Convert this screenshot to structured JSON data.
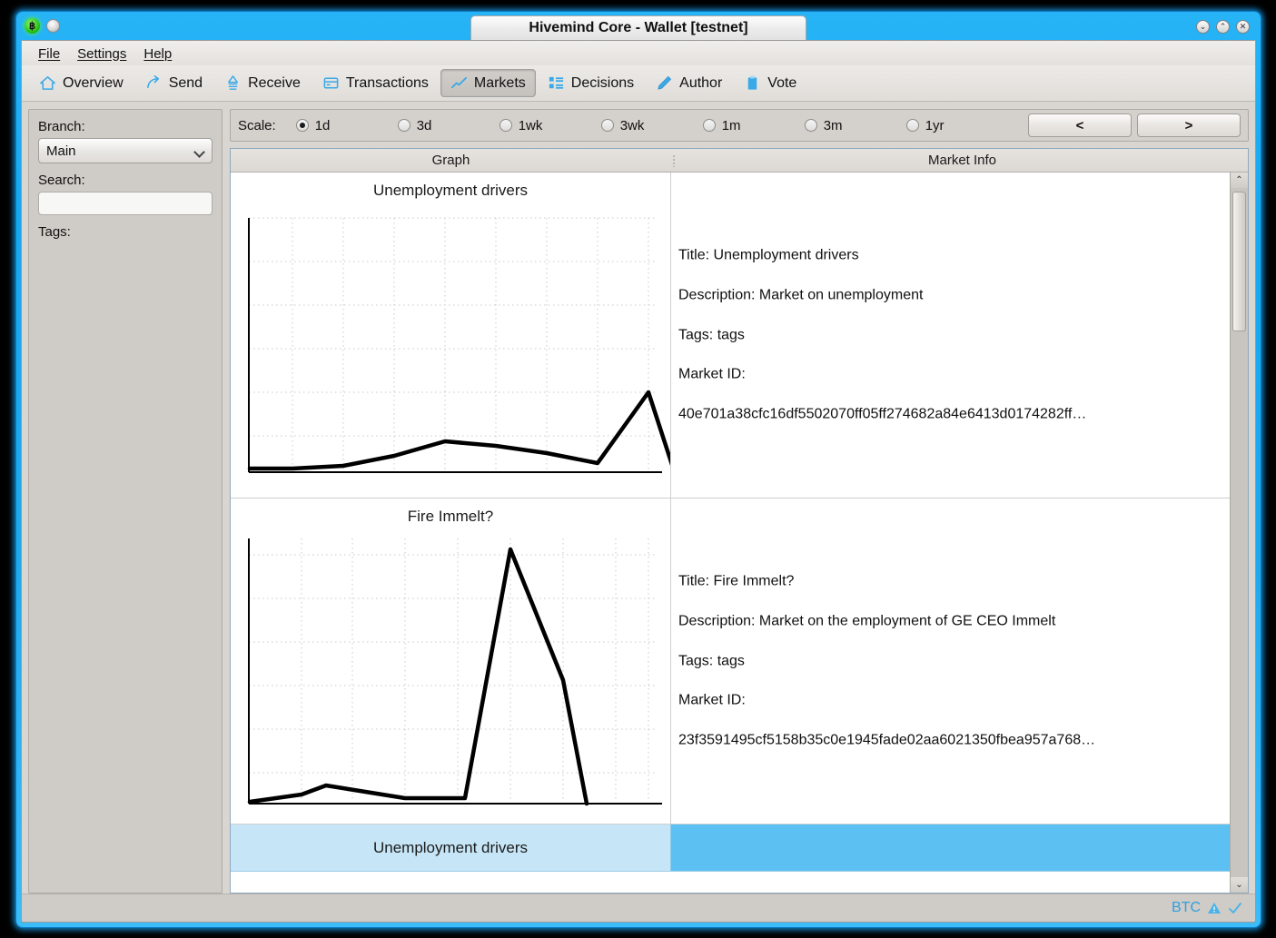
{
  "window": {
    "title": "Hivemind Core - Wallet [testnet]",
    "app_icon": "bitcoin-orb-icon",
    "buttons": {
      "minimize": "⌄",
      "maximize": "⌃",
      "close": "✕"
    }
  },
  "menubar": [
    {
      "label": "File",
      "accel": "F"
    },
    {
      "label": "Settings",
      "accel": "S"
    },
    {
      "label": "Help",
      "accel": "H"
    }
  ],
  "toolbar": {
    "items": [
      {
        "label": "Overview",
        "icon": "home-icon",
        "active": false
      },
      {
        "label": "Send",
        "icon": "send-arrow-icon",
        "active": false
      },
      {
        "label": "Receive",
        "icon": "receive-icon",
        "active": false
      },
      {
        "label": "Transactions",
        "icon": "transactions-card-icon",
        "active": false
      },
      {
        "label": "Markets",
        "icon": "markets-chart-icon",
        "active": true
      },
      {
        "label": "Decisions",
        "icon": "decisions-list-icon",
        "active": false
      },
      {
        "label": "Author",
        "icon": "pencil-icon",
        "active": false
      },
      {
        "label": "Vote",
        "icon": "clipboard-icon",
        "active": false
      }
    ]
  },
  "sidebar": {
    "branch_label": "Branch:",
    "branch_value": "Main",
    "branch_options": [
      "Main"
    ],
    "search_label": "Search:",
    "search_value": "",
    "search_placeholder": "",
    "tags_label": "Tags:"
  },
  "scale": {
    "label": "Scale:",
    "options": [
      {
        "label": "1d",
        "selected": true
      },
      {
        "label": "3d",
        "selected": false
      },
      {
        "label": "1wk",
        "selected": false
      },
      {
        "label": "3wk",
        "selected": false
      },
      {
        "label": "1m",
        "selected": false
      },
      {
        "label": "3m",
        "selected": false
      },
      {
        "label": "1yr",
        "selected": false
      }
    ],
    "prev_label": "<",
    "next_label": ">"
  },
  "table": {
    "columns": [
      "Graph",
      "Market Info"
    ],
    "rows": [
      {
        "graph_title": "Unemployment drivers",
        "info": {
          "title_line": "Title: Unemployment drivers",
          "description_line": "Description: Market on unemployment",
          "tags_line": "Tags: tags",
          "market_id_label": "Market ID:",
          "market_id_value": "40e701a38cfc16df5502070ff05ff274682a84e6413d0174282ff…"
        }
      },
      {
        "graph_title": "Fire Immelt?",
        "info": {
          "title_line": "Title: Fire Immelt?",
          "description_line": "Description: Market on the employment of GE CEO Immelt",
          "tags_line": "Tags: tags",
          "market_id_label": "Market ID:",
          "market_id_value": "23f3591495cf5158b35c0e1945fade02aa6021350fbea957a768…"
        }
      }
    ],
    "selected_row_label": "Unemployment drivers"
  },
  "scrollbar": {
    "up_arrow": "⌃",
    "down_arrow": "⌄"
  },
  "statusbar": {
    "ticker": "BTC",
    "warning_icon": "warning-triangle-icon",
    "sync_icon": "check-sync-icon"
  },
  "colors": {
    "window_frame": "#16a8ef",
    "accent_blue": "#2f9fe0",
    "selection_light": "#c6e6f7",
    "selection_strong": "#5dc0f2",
    "chart_line": "#000000",
    "grid": "#c9c9c9"
  },
  "chart_data": [
    {
      "type": "line",
      "title": "Unemployment drivers",
      "xlabel": "",
      "ylabel": "",
      "grid": true,
      "legend": "none",
      "xlim": [
        0,
        9
      ],
      "ylim": [
        0,
        1
      ],
      "x": [
        0,
        1,
        2,
        3,
        4,
        5,
        6,
        7,
        8,
        9
      ],
      "y": [
        0.02,
        0.02,
        0.02,
        0.05,
        0.13,
        0.12,
        0.1,
        0.06,
        0.33,
        0.0
      ]
    },
    {
      "type": "line",
      "title": "Fire Immelt?",
      "xlabel": "",
      "ylabel": "",
      "grid": true,
      "legend": "none",
      "xlim": [
        0,
        9
      ],
      "ylim": [
        0,
        1
      ],
      "x": [
        0,
        1,
        2,
        3,
        4,
        5,
        6,
        7,
        8,
        9
      ],
      "y": [
        0.0,
        0.02,
        0.06,
        0.03,
        0.01,
        0.01,
        0.01,
        0.97,
        0.5,
        0.0
      ]
    }
  ]
}
